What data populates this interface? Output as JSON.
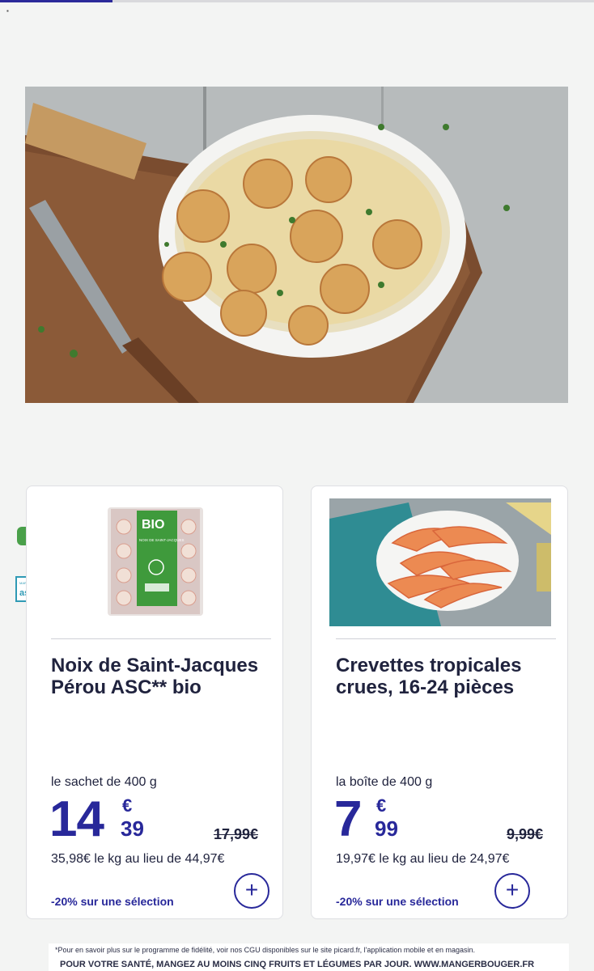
{
  "page": {
    "progress_percent": 19,
    "tiny_mark": "▪"
  },
  "badges": {
    "bio": "BIO",
    "asc_logo_text": "asc",
    "asc_logo_caption": "MARINE STEWARDSHIP"
  },
  "products": [
    {
      "title": "Noix de Saint-Jacques Pérou ASC** bio",
      "package_label": "BIO",
      "package_text": "NOIX DE SAINT-JACQUES",
      "unit": "le sachet de 400 g",
      "price_int": "14",
      "price_currency": "€",
      "price_dec": "39",
      "old_price": "17,99€",
      "per_kg": "35,98€ le kg au lieu de 44,97€",
      "promo": "-20% sur une sélection",
      "add_label": "+"
    },
    {
      "title": "Crevettes tropicales crues, 16-24 pièces",
      "unit": "la boîte de 400 g",
      "price_int": "7",
      "price_currency": "€",
      "price_dec": "99",
      "old_price": "9,99€",
      "per_kg": "19,97€ le kg au lieu de 24,97€",
      "promo": "-20% sur une sélection",
      "add_label": "+"
    }
  ],
  "footer": {
    "footnote": "*Pour en savoir plus sur le programme de fidélité, voir nos CGU disponibles sur le site picard.fr, l'application mobile et en magasin.",
    "health": "POUR VOTRE SANTÉ, MANGEZ AU MOINS CINQ FRUITS ET LÉGUMES PAR JOUR. WWW.MANGERBOUGER.FR"
  },
  "colors": {
    "brand_blue": "#28289a",
    "bio_green": "#4aa04a",
    "asc_blue": "#2f9ab5"
  }
}
